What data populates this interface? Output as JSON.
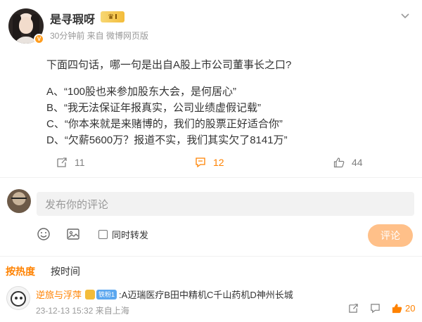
{
  "post": {
    "username": "是寻瑕呀",
    "vip_label": "Ⅰ",
    "meta": "30分钟前 来自 微博网页版",
    "question": "下面四句话，哪一句是出自A股上市公司董事长之口?",
    "options": [
      "A、“100股也来参加股东大会，是何居心”",
      "B、“我无法保证年报真实，公司业绩虚假记载”",
      "C、“你本来就是来赌博的，我们的股票正好适合你”",
      "D、“欠薪5600万？报道不实，我们其实欠了8141万”"
    ]
  },
  "actions": {
    "repost_count": "11",
    "comment_count": "12",
    "like_count": "44"
  },
  "compose": {
    "placeholder": "发布你的评论",
    "repost_label": "同时转发",
    "submit_label": "评论"
  },
  "sort_tabs": [
    "按热度",
    "按时间"
  ],
  "comment": {
    "username": "逆旅与浮萍",
    "fan_badge": "铁粉1",
    "text": ":A迈瑞医疗B田中精机C千山药机D神州长城",
    "meta": "23-12-13 15:32 来自上海",
    "like_count": "20"
  },
  "colors": {
    "accent": "#ff8200",
    "muted": "#999999",
    "submit_bg": "#ffc089"
  }
}
